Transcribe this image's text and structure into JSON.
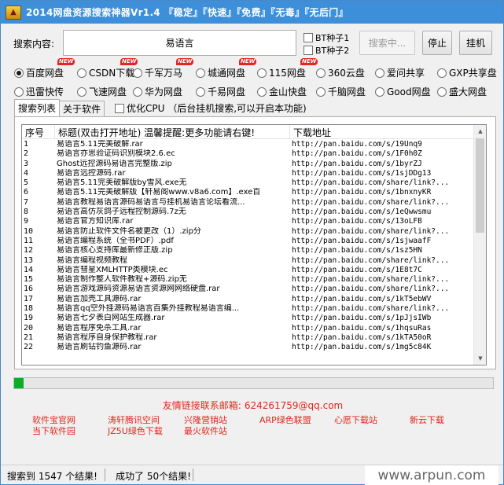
{
  "window": {
    "title": "2014网盘资源搜索神器Vr1.4 『稳定』『快速』『免费』『无毒』『无后门』",
    "icon": "shield-logo-icon",
    "title_color": "#3c8fd8"
  },
  "search": {
    "label": "搜索内容:",
    "value": "易语言",
    "bt_seed_1": "BT种子1",
    "bt_seed_2": "BT种子2",
    "search_button": "搜索中...",
    "stop_button": "停止",
    "hangup_button": "挂机"
  },
  "sources": {
    "row1": [
      {
        "label": "百度网盘",
        "selected": true,
        "new": true
      },
      {
        "label": "CSDN下载",
        "selected": false,
        "new": true
      },
      {
        "label": "千军万马",
        "selected": false,
        "new": true
      },
      {
        "label": "城通网盘",
        "selected": false,
        "new": true
      },
      {
        "label": "115网盘",
        "selected": false,
        "new": true
      },
      {
        "label": "360云盘",
        "selected": false,
        "new": false
      },
      {
        "label": "爱问共享",
        "selected": false,
        "new": false
      },
      {
        "label": "GXP共享盘",
        "selected": false,
        "new": false
      }
    ],
    "row2": [
      {
        "label": "迅雷快传",
        "selected": false
      },
      {
        "label": "飞速网盘",
        "selected": false
      },
      {
        "label": "华为网盘",
        "selected": false
      },
      {
        "label": "千易网盘",
        "selected": false
      },
      {
        "label": "金山快盘",
        "selected": false
      },
      {
        "label": "千脑网盘",
        "selected": false
      },
      {
        "label": "Good网盘",
        "selected": false
      },
      {
        "label": "盛大网盘",
        "selected": false
      }
    ],
    "new_badge": "NEW"
  },
  "tabs": {
    "search_list": "搜索列表",
    "about": "关于软件",
    "optimize_cpu": "优化CPU （后台挂机搜索,可以开启本功能)"
  },
  "table": {
    "headers": [
      "序号",
      "标题(双击打开地址) 温馨提醒:更多功能请右键!",
      "下载地址"
    ],
    "rows": [
      [
        "1",
        "易语言5.11完美破解.rar",
        "http://pan.baidu.com/s/19Unq9"
      ],
      [
        "2",
        "易语言亦思验证码识别模块2.6.ec",
        "http://pan.baidu.com/s/1F0h0Z"
      ],
      [
        "3",
        "Ghost远控源码易语言完整版.zip",
        "http://pan.baidu.com/s/1byrZJ"
      ],
      [
        "4",
        "易语言远控源码.rar",
        "http://pan.baidu.com/s/1sjDDg13"
      ],
      [
        "5",
        "易语言5.11完美破解版by雪风.exe无",
        "http://pan.baidu.com/share/link?..."
      ],
      [
        "6",
        "易语言5.11完美破解版【轩易阁www.v8a6.com】.exe百",
        "http://pan.baidu.com/s/1bnxnyKR"
      ],
      [
        "7",
        "易语言教程易语言源码易语言与挂机易语言论坛看流...",
        "http://pan.baidu.com/share/link?..."
      ],
      [
        "8",
        "易语言高仿灰鸽子远程控制源码.7z无",
        "http://pan.baidu.com/s/1eQwwsmu"
      ],
      [
        "9",
        "易语言官方知识库.rar",
        "http://pan.baidu.com/s/13oLFB"
      ],
      [
        "10",
        "易语言防止软件文件名被更改（1）.zip分",
        "http://pan.baidu.com/share/link?..."
      ],
      [
        "11",
        "易语言编程系统（全书PDF）.pdf",
        "http://pan.baidu.com/s/1sjwaafF"
      ],
      [
        "12",
        "易语言核心支持库最新修正版.zip",
        "http://pan.baidu.com/s/1sz5HN"
      ],
      [
        "13",
        "易语言编程视频教程",
        "http://pan.baidu.com/share/link?..."
      ],
      [
        "14",
        "易语言彗星XMLHTTP类模块.ec",
        "http://pan.baidu.com/s/1E8t7C"
      ],
      [
        "15",
        "易语言制作整人软件教程+源码.zip无",
        "http://pan.baidu.com/share/link?..."
      ],
      [
        "16",
        "易语言游戏源码资源易语言资源网网络硬盘.rar",
        "http://pan.baidu.com/share/link?..."
      ],
      [
        "17",
        "易语言加壳工具源码.rar",
        "http://pan.baidu.com/s/1kT5ebWV"
      ],
      [
        "18",
        "易语言qq空外挂源码易语言百集外挂教程易语言编...",
        "http://pan.baidu.com/share/link?..."
      ],
      [
        "19",
        "易语言七夕表白网站生成器.rar",
        "http://pan.baidu.com/s/1pJjsIWb"
      ],
      [
        "20",
        "易语言程序免杀工具.rar",
        "http://pan.baidu.com/s/1hqsuRas"
      ],
      [
        "21",
        "易语言程序自身保护教程.rar",
        "http://pan.baidu.com/s/1kTA50oR"
      ],
      [
        "22",
        "易语言刷钻钓鱼源码.rar",
        "http://pan.baidu.com/s/1mg5c84K"
      ]
    ]
  },
  "progress": {
    "value": 0.02,
    "color": "#06b025"
  },
  "footer": {
    "sponsor_label": "友情链接联系邮箱:",
    "sponsor_email": "624261759@qq.com",
    "links": [
      {
        "top": "软件宝官网",
        "bottom": "当下软件园"
      },
      {
        "top": "涛轩腾讯空间",
        "bottom": "JZ5U绿色下载"
      },
      {
        "top": "兴隆营销站",
        "bottom": "最火软件站"
      },
      {
        "top": "ARP绿色联盟",
        "bottom": ""
      },
      {
        "top": "心愿下载站",
        "bottom": ""
      },
      {
        "top": "新云下载",
        "bottom": ""
      }
    ],
    "link_color": "#e0281c"
  },
  "status": {
    "found": "搜索到 1547 个结果!",
    "success": "成功了 50个结果!",
    "watermark": "www.arpun.com"
  }
}
